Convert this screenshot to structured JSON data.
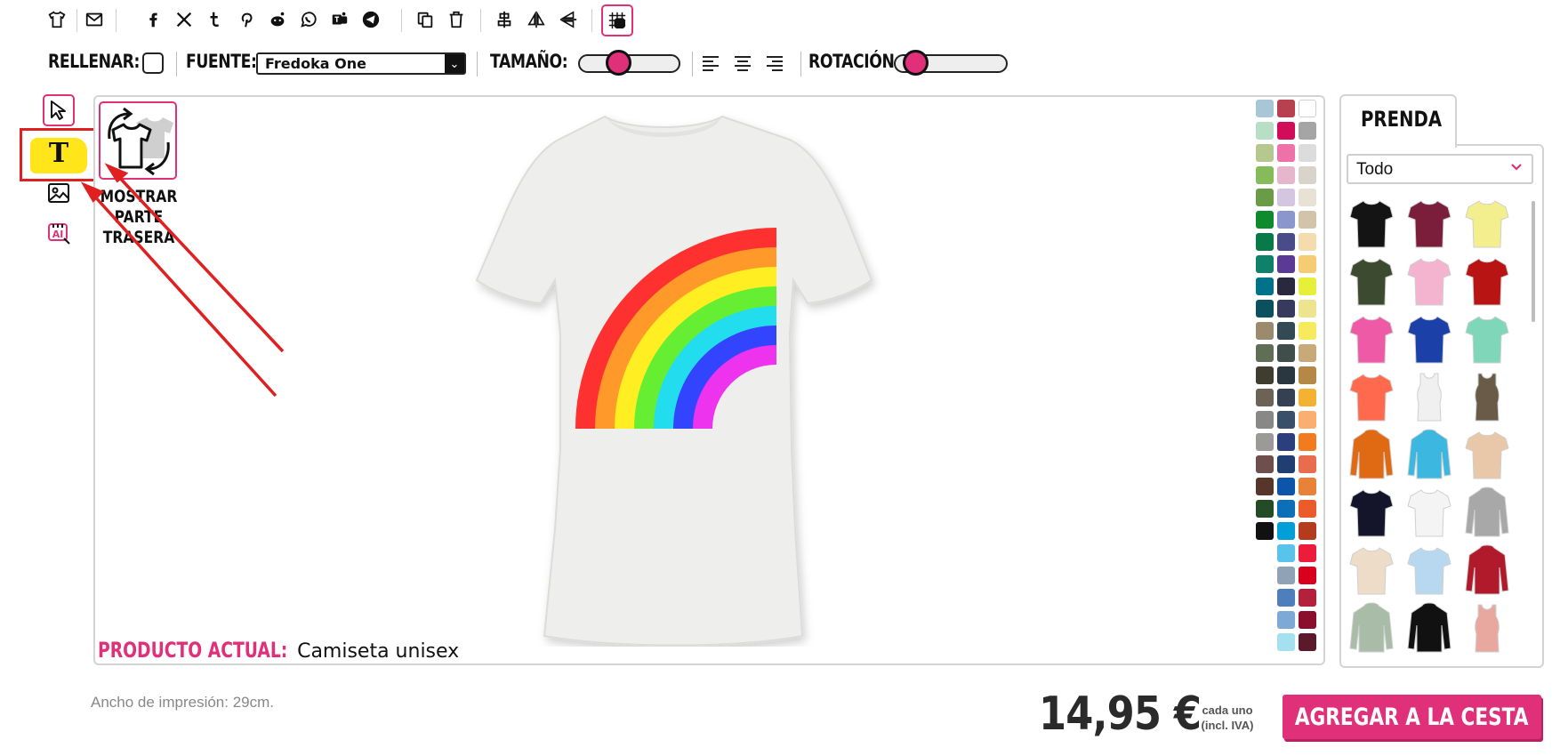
{
  "toolbar": {
    "fill_label": "RELLENAR:",
    "font_label": "FUENTE:",
    "font_value": "Fredoka One",
    "size_label": "TAMAÑO:",
    "size_value": 0.36,
    "rotation_label": "ROTACIÓN:",
    "rotation_value": 0.08,
    "icons": [
      "tshirt-icon",
      "email-icon",
      "facebook-icon",
      "x-icon",
      "tumblr-icon",
      "pinterest-icon",
      "reddit-icon",
      "whatsapp-icon",
      "teams-icon",
      "telegram-icon",
      "duplicate-icon",
      "delete-icon",
      "align-center-icon",
      "flip-horizontal-icon",
      "flip-vertical-icon",
      "grid-icon"
    ]
  },
  "left_tools": [
    "select-tool-icon",
    "text-tool-icon",
    "image-tool-icon",
    "ai-tool-icon"
  ],
  "canvas": {
    "back_label": "MOSTRAR PARTE TRASERA",
    "current_product_label": "PRODUCTO ACTUAL:",
    "current_product_value": "Camiseta unisex",
    "tshirt_color": "#eeeeec",
    "rainbow_colors": [
      "#ff3030",
      "#ff9a2a",
      "#ffee22",
      "#66ee33",
      "#22ddee",
      "#3344ff",
      "#ee33ee"
    ]
  },
  "palette": {
    "col1": [
      "#a9c6d6",
      "#b7dfc6",
      "#b5c98f",
      "#86bb5a",
      "#6a9c47",
      "#0f8a2d",
      "#077a47",
      "#0f8069",
      "#00738a",
      "#0b505f",
      "#9b8a6e",
      "#5f6e55",
      "#3f3c30",
      "#6c6255",
      "#888886",
      "#9b9a98",
      "#6e4f4d",
      "#553628",
      "#254a26",
      "#111111"
    ],
    "col2": [
      "#b8414f",
      "#d10d5a",
      "#ec72a8",
      "#e6b6cd",
      "#d4c6e0",
      "#8b96cc",
      "#4a4c8a",
      "#5b3a96",
      "#29283f",
      "#363a5c",
      "#334a55",
      "#3f4e4b",
      "#2b3740",
      "#344152",
      "#3a4f69",
      "#2c3f7d",
      "#203e72",
      "#0d55a9",
      "#0d6fb8",
      "#009fd7",
      "#59c4ea",
      "#8fa3b6",
      "#4f7ebd",
      "#7da9d6",
      "#a4e0ef"
    ],
    "col3": [
      "#ffffff",
      "#a5a5a5",
      "#dcdcdc",
      "#d8d4cc",
      "#e7e1d6",
      "#d2c4aa",
      "#f3dcae",
      "#f5cc72",
      "#e6ef3a",
      "#eee38e",
      "#f6ea5e",
      "#c8aa7a",
      "#b58848",
      "#f4b233",
      "#f9af72",
      "#f27a1f",
      "#e86c4e",
      "#e78236",
      "#ec5b2a",
      "#b53b1f",
      "#ec1c3a",
      "#d8001d",
      "#b4213b",
      "#8b0f2d",
      "#5b1a2c"
    ]
  },
  "panel": {
    "tab_label": "PRENDA",
    "category_value": "Todo",
    "garments": [
      {
        "name": "black-tshirt",
        "color": "#141414"
      },
      {
        "name": "burgundy-tshirt",
        "color": "#7a1e3c"
      },
      {
        "name": "yellow-tshirt",
        "color": "#f4ef8e"
      },
      {
        "name": "olive-tshirt",
        "color": "#3c4a30"
      },
      {
        "name": "pink-tshirt",
        "color": "#f4b4cf"
      },
      {
        "name": "red-tshirt",
        "color": "#b81414"
      },
      {
        "name": "fuchsia-tshirt",
        "color": "#ee5aa6"
      },
      {
        "name": "royal-blue-tshirt",
        "color": "#1b40a8"
      },
      {
        "name": "mint-tshirt",
        "color": "#7fd6b8"
      },
      {
        "name": "coral-tshirt",
        "color": "#ff6a4e"
      },
      {
        "name": "white-tank",
        "color": "#f0f0f0"
      },
      {
        "name": "brown-tank",
        "color": "#6a5a48"
      },
      {
        "name": "orange-hoodie",
        "color": "#e06a14"
      },
      {
        "name": "turquoise-hoodie",
        "color": "#3cb8e0"
      },
      {
        "name": "tie-dye-tshirt",
        "color": "#e8c8a8"
      },
      {
        "name": "navy-tshirt",
        "color": "#14142a"
      },
      {
        "name": "raglan-tshirt",
        "color": "#f4f4f4"
      },
      {
        "name": "grey-hoodie",
        "color": "#a8a8a8"
      },
      {
        "name": "cream-tshirt",
        "color": "#ecdcc8"
      },
      {
        "name": "dip-dye-tshirt",
        "color": "#b8d8f0"
      },
      {
        "name": "varsity-jacket",
        "color": "#b01a2a"
      },
      {
        "name": "sage-longsleeve",
        "color": "#a8bca8"
      },
      {
        "name": "black-orange-hoodie",
        "color": "#111111"
      },
      {
        "name": "rose-tank",
        "color": "#e8a8a0"
      }
    ]
  },
  "footer": {
    "print_width": "Ancho de impresión: 29cm.",
    "price": "14,95 €",
    "price_note_1": "cada uno",
    "price_note_2": "(incl. IVA)",
    "add_to_cart": "AGREGAR A LA CESTA"
  },
  "colors": {
    "accent": "#e0307a",
    "highlight": "#ffe51a",
    "annotation": "#e02020"
  }
}
